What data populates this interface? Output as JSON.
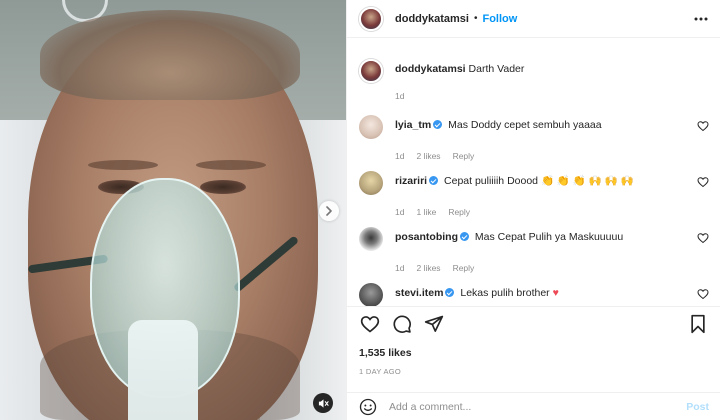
{
  "post": {
    "author": "doddykatamsi",
    "separator": "•",
    "follow_label": "Follow",
    "caption_user": "doddykatamsi",
    "caption_text": "Darth Vader",
    "caption_time": "1d"
  },
  "comments": [
    {
      "user": "lyia_tm",
      "verified": true,
      "text": "Mas Doddy cepet sembuh yaaaa",
      "time": "1d",
      "likes": "2 likes",
      "reply": "Reply",
      "avatar_color": "#e8d9d0"
    },
    {
      "user": "rizariri",
      "verified": true,
      "text": "Cepat puliiiih Doood",
      "emoji": "👏 👏 👏 🙌 🙌 🙌",
      "time": "1d",
      "likes": "1 like",
      "reply": "Reply",
      "avatar_color": "#b5a27a"
    },
    {
      "user": "posantobing",
      "verified": true,
      "text": "Mas Cepat Pulih ya Maskuuuuu",
      "time": "1d",
      "likes": "2 likes",
      "reply": "Reply",
      "avatar_color": "#d9d9d9"
    },
    {
      "user": "stevi.item",
      "verified": true,
      "text": "Lekas pulih brother",
      "emoji": "♥",
      "avatar_color": "#6f6f6f"
    }
  ],
  "stats": {
    "likes": "1,535 likes",
    "time_ago": "1 DAY AGO"
  },
  "composer": {
    "placeholder": "Add a comment...",
    "post_label": "Post"
  },
  "icons": {
    "more": "more-horizontal-icon",
    "like": "heart-icon",
    "comment": "comment-bubble-icon",
    "share": "paper-plane-icon",
    "save": "bookmark-icon",
    "emoji": "smiley-icon",
    "next": "chevron-right-icon",
    "mute": "speaker-muted-icon"
  },
  "colors": {
    "accent": "#0095f6",
    "verified": "#3897f0",
    "muted_text": "#8e8e8e",
    "post_disabled": "#b2dffc",
    "heart_red": "#ed4956"
  }
}
